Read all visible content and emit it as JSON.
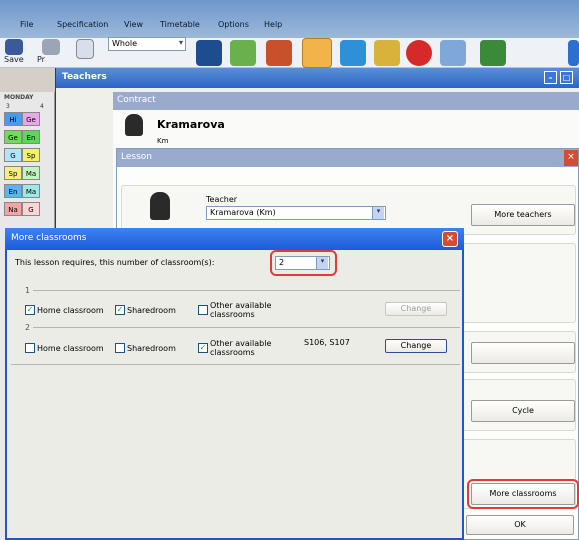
{
  "menu": [
    "File",
    "Specification",
    "View",
    "Timetable",
    "Options",
    "Help"
  ],
  "toolbar": {
    "save_label": "Save",
    "print_label": "Pr",
    "view_combo": "Whole"
  },
  "teachers_window": {
    "title": "Teachers"
  },
  "timetable": {
    "day": "MONDAY",
    "periods": [
      "3",
      "4"
    ],
    "cells": [
      {
        "t": "Hi",
        "c": "#4a9bf0"
      },
      {
        "t": "Ge",
        "c": "#e9a6e9"
      },
      {
        "t": "Ge",
        "c": "#6fdd5a"
      },
      {
        "t": "En",
        "c": "#5cd65c"
      },
      {
        "t": "G",
        "c": "#b0e4f9"
      },
      {
        "t": "Sp",
        "c": "#f1f16a"
      },
      {
        "t": "Sp",
        "c": "#f6ef7a"
      },
      {
        "t": "Ma",
        "c": "#c0f7c0"
      },
      {
        "t": "En",
        "c": "#5cb4f3"
      },
      {
        "t": "Ma",
        "c": "#9de8e8"
      },
      {
        "t": "Na",
        "c": "#f3a5a5"
      },
      {
        "t": "G",
        "c": "#f9d5d5"
      }
    ]
  },
  "contract": {
    "header": "Contract",
    "teacher_name": "Kramarova",
    "teacher_short": "Km"
  },
  "lesson": {
    "header": "Lesson",
    "teacher_label": "Teacher",
    "teacher_value": "Kramarova (Km)",
    "more_teachers": "More teachers",
    "cycle": "Cycle",
    "more_classrooms": "More classrooms",
    "ok": "OK"
  },
  "dialog": {
    "title": "More classrooms",
    "prompt": "This lesson requires, this number of classroom(s):",
    "count": "2",
    "rows": [
      {
        "index": "1",
        "home": {
          "label": "Home classroom",
          "checked": true
        },
        "shared": {
          "label": "Sharedroom",
          "checked": true
        },
        "other": {
          "label_1": "Other available",
          "label_2": "classrooms",
          "checked": false
        },
        "rooms": "",
        "change": "Change",
        "change_enabled": false
      },
      {
        "index": "2",
        "home": {
          "label": "Home classroom",
          "checked": false
        },
        "shared": {
          "label": "Sharedroom",
          "checked": false
        },
        "other": {
          "label_1": "Other available",
          "label_2": "classrooms",
          "checked": true
        },
        "rooms": "S106, S107",
        "change": "Change",
        "change_enabled": true
      }
    ]
  },
  "colors": {
    "highlight": "#e03a3a",
    "title_blue": "#1d5ad8",
    "check_green": "#21a121"
  }
}
